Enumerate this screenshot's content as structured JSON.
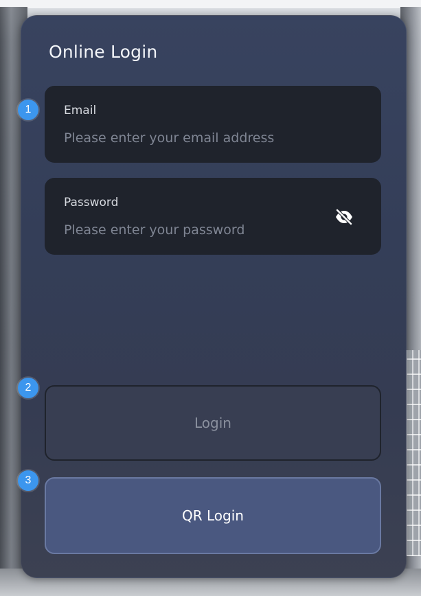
{
  "login_panel": {
    "title": "Online Login",
    "email": {
      "label": "Email",
      "placeholder": "Please enter your email address",
      "value": ""
    },
    "password": {
      "label": "Password",
      "placeholder": "Please enter your password",
      "value": "",
      "visibility_icon": "eye-slash-icon"
    },
    "login_button_label": "Login",
    "qr_login_button_label": "QR Login"
  },
  "annotations": {
    "marker_1": "1",
    "marker_2": "2",
    "marker_3": "3"
  },
  "colors": {
    "panel_bg": "#38435f",
    "field_bg": "#1f232c",
    "qr_button_bg": "#4a5880",
    "marker_blue": "#3c96ee"
  }
}
